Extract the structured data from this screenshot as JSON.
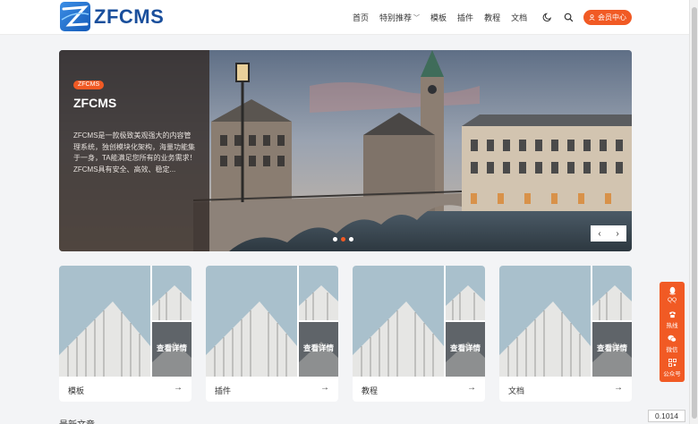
{
  "header": {
    "logo_text": "ZFCMS",
    "nav": [
      {
        "label": "首页"
      },
      {
        "label": "特别推荐",
        "has_dropdown": true
      },
      {
        "label": "模板"
      },
      {
        "label": "插件"
      },
      {
        "label": "教程"
      },
      {
        "label": "文档"
      }
    ],
    "theme_icon": "moon-icon",
    "search_icon": "search-icon",
    "member_button": "会员中心",
    "accent_color": "#f15a24"
  },
  "banner": {
    "tag": "ZFCMS",
    "title": "ZFCMS",
    "description": "ZFCMS是一款极致美观强大的内容管理系统，独创模块化架构，海量功能集于一身，TA能满足您所有的业务需求！ZFCMS具有安全、高效、稳定...",
    "slides": 3,
    "active_slide": 2
  },
  "cards": [
    {
      "label": "模板",
      "overlay": "查看详情"
    },
    {
      "label": "插件",
      "overlay": "查看详情"
    },
    {
      "label": "教程",
      "overlay": "查看详情"
    },
    {
      "label": "文档",
      "overlay": "查看详情"
    }
  ],
  "float_bar": [
    {
      "label": "QQ",
      "icon": "qq-icon"
    },
    {
      "label": "热线",
      "icon": "phone-icon"
    },
    {
      "label": "微信",
      "icon": "wechat-icon"
    },
    {
      "label": "公众号",
      "icon": "qrcode-icon"
    }
  ],
  "section_title": "最新文章",
  "counter": "0.1014"
}
